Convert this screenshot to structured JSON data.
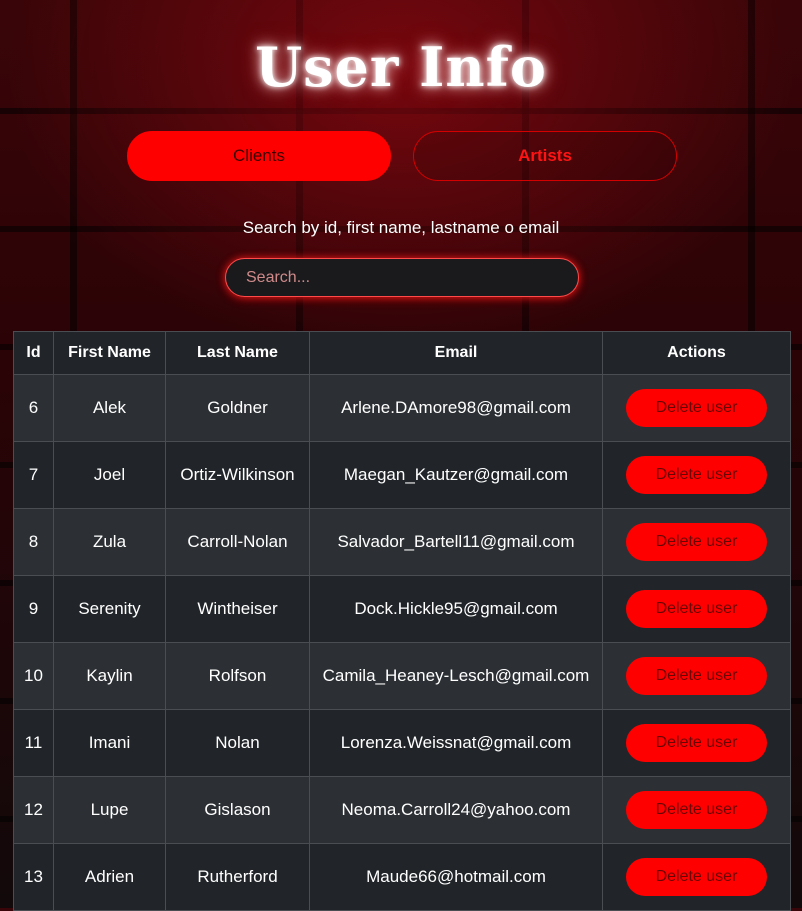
{
  "header": {
    "title": "User Info"
  },
  "tabs": [
    {
      "label": "Clients",
      "active": true
    },
    {
      "label": "Artists",
      "active": false
    }
  ],
  "search": {
    "label": "Search by id, first name, lastname o email",
    "placeholder": "Search...",
    "value": ""
  },
  "table": {
    "columns": [
      "Id",
      "First Name",
      "Last Name",
      "Email",
      "Actions"
    ],
    "rows": [
      {
        "id": "6",
        "first_name": "Alek",
        "last_name": "Goldner",
        "email": "Arlene.DAmore98@gmail.com",
        "action": "Delete user"
      },
      {
        "id": "7",
        "first_name": "Joel",
        "last_name": "Ortiz-Wilkinson",
        "email": "Maegan_Kautzer@gmail.com",
        "action": "Delete user"
      },
      {
        "id": "8",
        "first_name": "Zula",
        "last_name": "Carroll-Nolan",
        "email": "Salvador_Bartell11@gmail.com",
        "action": "Delete user"
      },
      {
        "id": "9",
        "first_name": "Serenity",
        "last_name": "Wintheiser",
        "email": "Dock.Hickle95@gmail.com",
        "action": "Delete user"
      },
      {
        "id": "10",
        "first_name": "Kaylin",
        "last_name": "Rolfson",
        "email": "Camila_Heaney-Lesch@gmail.com",
        "action": "Delete user"
      },
      {
        "id": "11",
        "first_name": "Imani",
        "last_name": "Nolan",
        "email": "Lorenza.Weissnat@gmail.com",
        "action": "Delete user"
      },
      {
        "id": "12",
        "first_name": "Lupe",
        "last_name": "Gislason",
        "email": "Neoma.Carroll24@yahoo.com",
        "action": "Delete user"
      },
      {
        "id": "13",
        "first_name": "Adrien",
        "last_name": "Rutherford",
        "email": "Maude66@hotmail.com",
        "action": "Delete user"
      }
    ]
  },
  "colors": {
    "accent": "#ff0000",
    "table_row_odd": "#2c3034",
    "table_row_even": "#212529",
    "delete_text": "#6a0505",
    "artists_text": "#ff1414"
  }
}
